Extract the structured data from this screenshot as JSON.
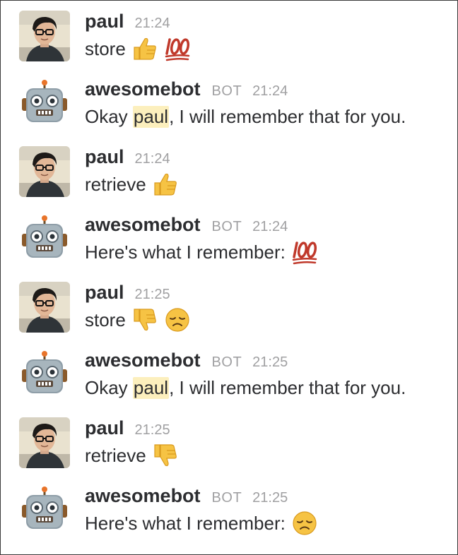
{
  "messages": [
    {
      "sender": "paul",
      "is_bot": false,
      "time": "21:24",
      "text": "store",
      "mention": null,
      "text_after": "",
      "emojis": [
        "thumbs-up",
        "hundred-points"
      ]
    },
    {
      "sender": "awesomebot",
      "is_bot": true,
      "bot_label": "BOT",
      "time": "21:24",
      "text": "Okay ",
      "mention": "paul",
      "text_after": ", I will remember that for you.",
      "emojis": []
    },
    {
      "sender": "paul",
      "is_bot": false,
      "time": "21:24",
      "text": "retrieve",
      "mention": null,
      "text_after": "",
      "emojis": [
        "thumbs-up"
      ]
    },
    {
      "sender": "awesomebot",
      "is_bot": true,
      "bot_label": "BOT",
      "time": "21:24",
      "text": "Here's what I remember:",
      "mention": null,
      "text_after": "",
      "emojis": [
        "hundred-points"
      ]
    },
    {
      "sender": "paul",
      "is_bot": false,
      "time": "21:25",
      "text": "store",
      "mention": null,
      "text_after": "",
      "emojis": [
        "thumbs-down",
        "disappointed-face"
      ]
    },
    {
      "sender": "awesomebot",
      "is_bot": true,
      "bot_label": "BOT",
      "time": "21:25",
      "text": "Okay ",
      "mention": "paul",
      "text_after": ", I will remember that for you.",
      "emojis": []
    },
    {
      "sender": "paul",
      "is_bot": false,
      "time": "21:25",
      "text": "retrieve",
      "mention": null,
      "text_after": "",
      "emojis": [
        "thumbs-down"
      ]
    },
    {
      "sender": "awesomebot",
      "is_bot": true,
      "bot_label": "BOT",
      "time": "21:25",
      "text": "Here's what I remember:",
      "mention": null,
      "text_after": "",
      "emojis": [
        "disappointed-face"
      ]
    }
  ],
  "colors": {
    "name_text": "#2c2d30",
    "meta_text": "#a0a0a2",
    "mention_bg": "#fcefbd",
    "emoji_yellow": "#f6c344",
    "hundred_red": "#c0392b"
  }
}
